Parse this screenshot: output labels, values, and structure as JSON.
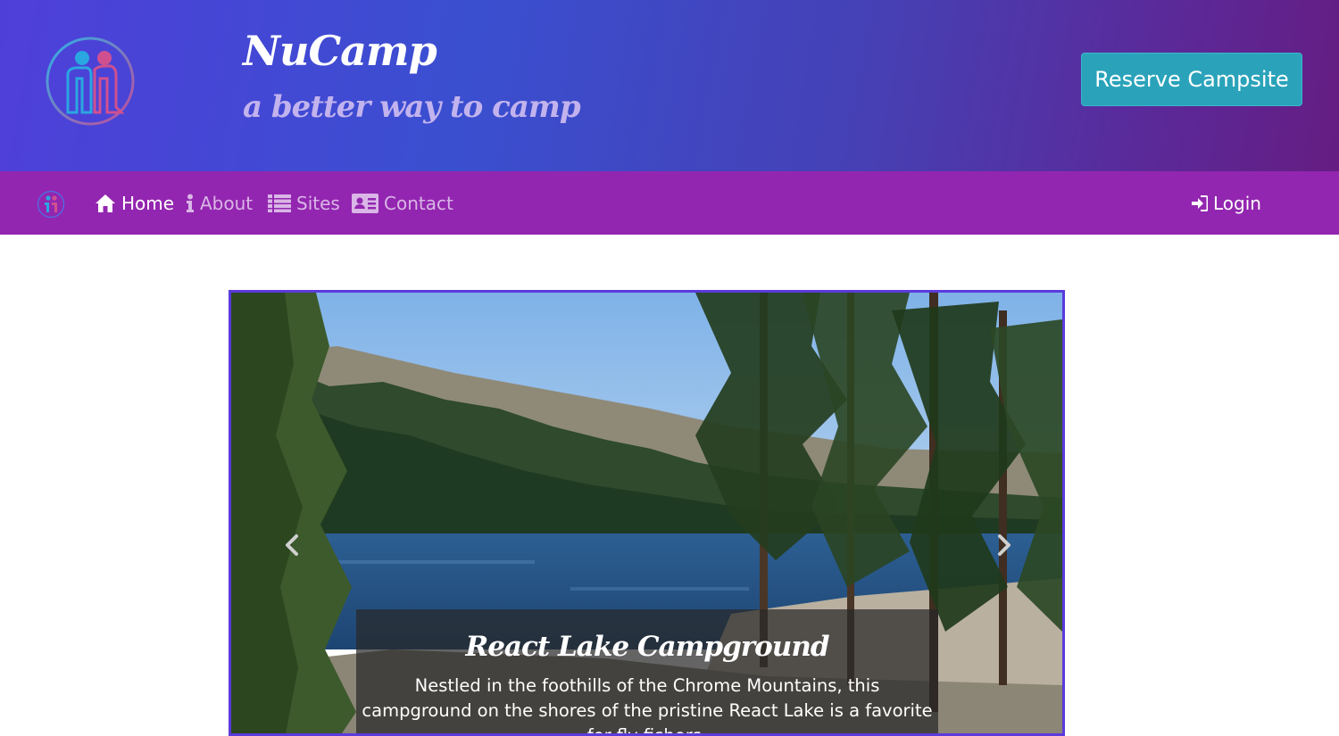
{
  "header": {
    "title": "NuCamp",
    "subtitle": "a better way to camp",
    "reserve_label": "Reserve Campsite"
  },
  "navbar": {
    "items": [
      {
        "label": "Home",
        "icon": "home-icon",
        "active": true
      },
      {
        "label": "About",
        "icon": "info-icon",
        "active": false
      },
      {
        "label": "Sites",
        "icon": "list-icon",
        "active": false
      },
      {
        "label": "Contact",
        "icon": "address-card-icon",
        "active": false
      }
    ],
    "login_label": "Login"
  },
  "carousel": {
    "slide_title": "React Lake Campground",
    "slide_text": "Nestled in the foothills of the Chrome Mountains, this campground on the shores of the pristine React Lake is a favorite for fly fishers."
  },
  "colors": {
    "navbar": "#9326b0",
    "accent_button": "#2aa3ba",
    "carousel_border": "#5b3bdc"
  }
}
